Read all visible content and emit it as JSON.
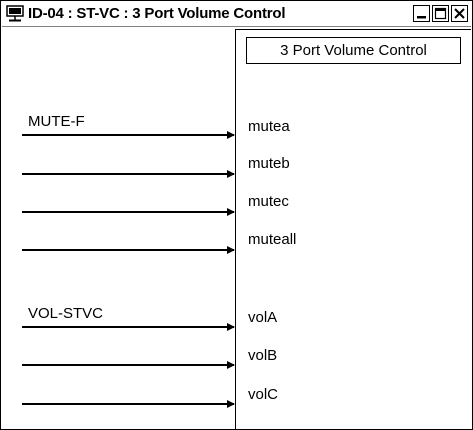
{
  "window": {
    "title": "ID-04 : ST-VC : 3 Port Volume Control"
  },
  "block": {
    "title": "3 Port Volume Control",
    "ports": [
      "mutea",
      "muteb",
      "mutec",
      "muteall",
      "volA",
      "volB",
      "volC"
    ]
  },
  "signals": {
    "mute_group": "MUTE-F",
    "vol_group": "VOL-STVC"
  },
  "icons": {
    "app": "network-window-icon",
    "minimize": "minimize-icon",
    "maximize": "maximize-icon",
    "close": "close-icon"
  }
}
